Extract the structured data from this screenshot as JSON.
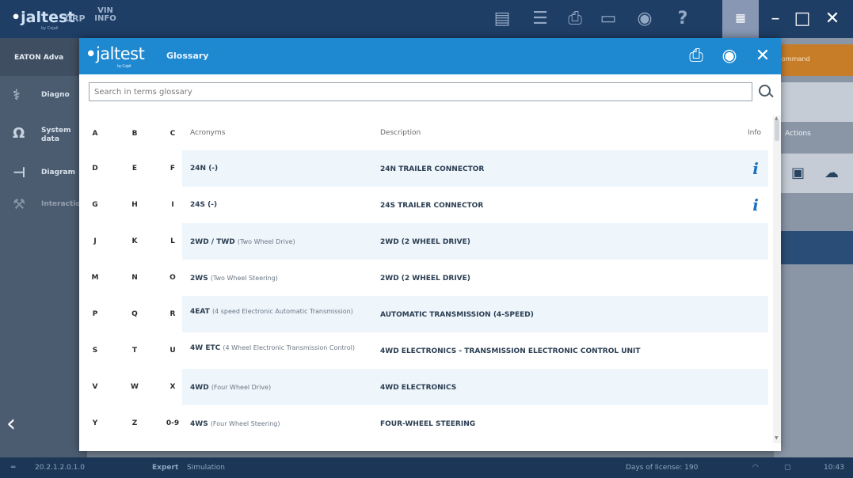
{
  "app": {
    "logo": "jaltest",
    "logo_sub": "by Cojali",
    "grp_label": "GRP",
    "vin_label": "VIN INFO",
    "sidebar_title": "EATON Adva",
    "sidebar": [
      {
        "icon": "diagnosis-icon",
        "label": "Diagno"
      },
      {
        "icon": "omega-icon",
        "label": "System data"
      },
      {
        "icon": "diagram-icon",
        "label": "Diagram"
      },
      {
        "icon": "tools-icon",
        "label": "Interactio"
      }
    ],
    "right_panel": {
      "orange_label": "ommand",
      "actions_label": "Actions"
    },
    "status": {
      "version": "20.2.1.2.0.1.0",
      "mode": "Expert",
      "simulation": "Simulation",
      "license": "Days of license: 190",
      "time": "10:43"
    },
    "colors": {
      "topbar": "#1f3e66",
      "modal_header": "#1e88d0",
      "accent_blue": "#1b6fbf",
      "row_alt": "#eef5fb"
    }
  },
  "glossary": {
    "logo": "jaltest",
    "logo_sub": "by Cojali",
    "title": "Glossary",
    "search_placeholder": "Search in terms glossary",
    "columns": {
      "acronyms": "Acronyms",
      "description": "Description",
      "info": "Info"
    },
    "letter_rows": [
      [
        "A",
        "B",
        "C"
      ],
      [
        "D",
        "E",
        "F"
      ],
      [
        "G",
        "H",
        "I"
      ],
      [
        "J",
        "K",
        "L"
      ],
      [
        "M",
        "N",
        "O"
      ],
      [
        "P",
        "Q",
        "R"
      ],
      [
        "S",
        "T",
        "U"
      ],
      [
        "V",
        "W",
        "X"
      ],
      [
        "Y",
        "Z",
        "0-9"
      ]
    ],
    "rows": [
      {
        "acronym": "24N (-)",
        "detail": "",
        "description": "24N TRAILER CONNECTOR",
        "info": true
      },
      {
        "acronym": "24S (-)",
        "detail": "",
        "description": "24S TRAILER CONNECTOR",
        "info": true
      },
      {
        "acronym": "2WD / TWD",
        "detail": "(Two Wheel Drive)",
        "description": "2WD (2 WHEEL DRIVE)",
        "info": false
      },
      {
        "acronym": "2WS",
        "detail": "(Two Wheel Steering)",
        "description": "2WD (2 WHEEL DRIVE)",
        "info": false
      },
      {
        "acronym": "4EAT",
        "detail": "(4 speed Electronic Automatic Transmission)",
        "description": "AUTOMATIC TRANSMISSION (4-SPEED)",
        "info": false
      },
      {
        "acronym": "4W ETC",
        "detail": "(4 Wheel Electronic Transmission Control)",
        "description": "4WD ELECTRONICS - TRANSMISSION ELECTRONIC CONTROL UNIT",
        "info": false
      },
      {
        "acronym": "4WD",
        "detail": "(Four Wheel Drive)",
        "description": "4WD ELECTRONICS",
        "info": false
      },
      {
        "acronym": "4WS",
        "detail": "(Four Wheel Steering)",
        "description": "FOUR-WHEEL STEERING",
        "info": false
      }
    ]
  }
}
